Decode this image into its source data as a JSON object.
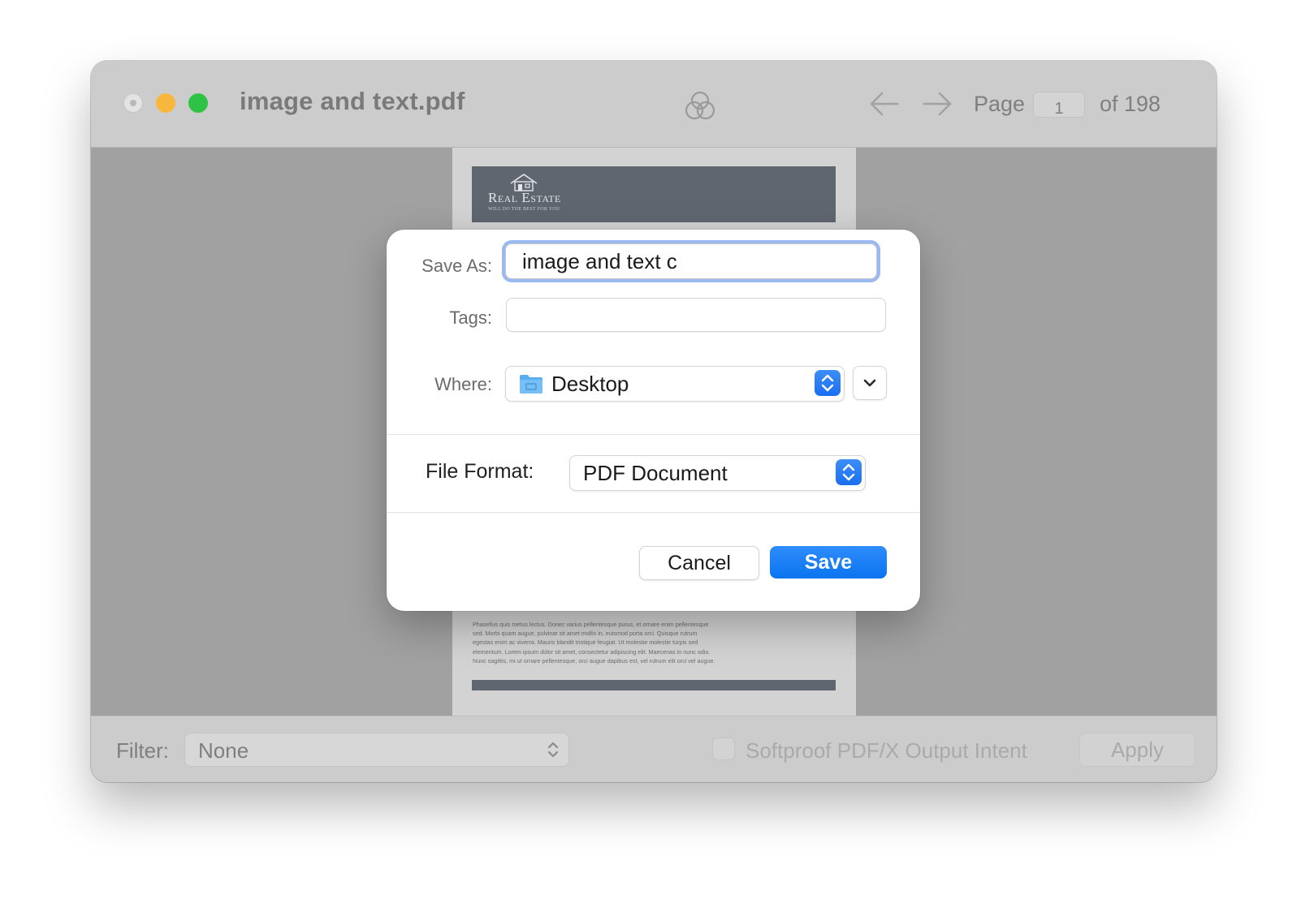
{
  "window": {
    "title": "image and text.pdf",
    "page_label": "Page",
    "page_number": "1",
    "page_of": "of 198"
  },
  "document": {
    "logo_text": "Real Estate",
    "logo_tagline": "WILL DO THE BEST FOR YOU",
    "body_text": "Phasellus quis metus lectus. Donec varius pellentesque purus, et ornare enim pellentesque sed. Morbi quam augue, pulvinar sit amet mollis in, euismod porta orci. Quisque rutrum egestas enim ac viverra. Mauris blandit tristique feugiat. Ut molestie molestie turpis sed elementum. Lorem ipsum dolor sit amet, consectetur adipiscing elit. Maecenas in nunc odio. Nunc sagittis, mi ut ornare pellentesque, orci augue dapibus est, vel rutrum elit orci vel augue."
  },
  "dialog": {
    "save_as_label": "Save As:",
    "save_as_value": "image and text c",
    "tags_label": "Tags:",
    "tags_value": "",
    "where_label": "Where:",
    "where_value": "Desktop",
    "file_format_label": "File Format:",
    "file_format_value": "PDF Document",
    "cancel_label": "Cancel",
    "save_label": "Save"
  },
  "bottombar": {
    "filter_label": "Filter:",
    "filter_value": "None",
    "softproof_label": "Softproof PDF/X Output Intent",
    "softproof_checked": false,
    "apply_label": "Apply"
  },
  "colors": {
    "accent": "#1a75f0",
    "close_button": "#e3e3e3",
    "minimize_button": "#f6b73c",
    "zoom_button": "#2fc345"
  },
  "icons": {
    "color_sync": "three-overlapping-circles-icon",
    "back": "arrow-left-icon",
    "forward": "arrow-right-icon",
    "folder": "folder-icon",
    "expand": "chevron-down-icon",
    "stepper": "up-down-chevrons-icon"
  }
}
